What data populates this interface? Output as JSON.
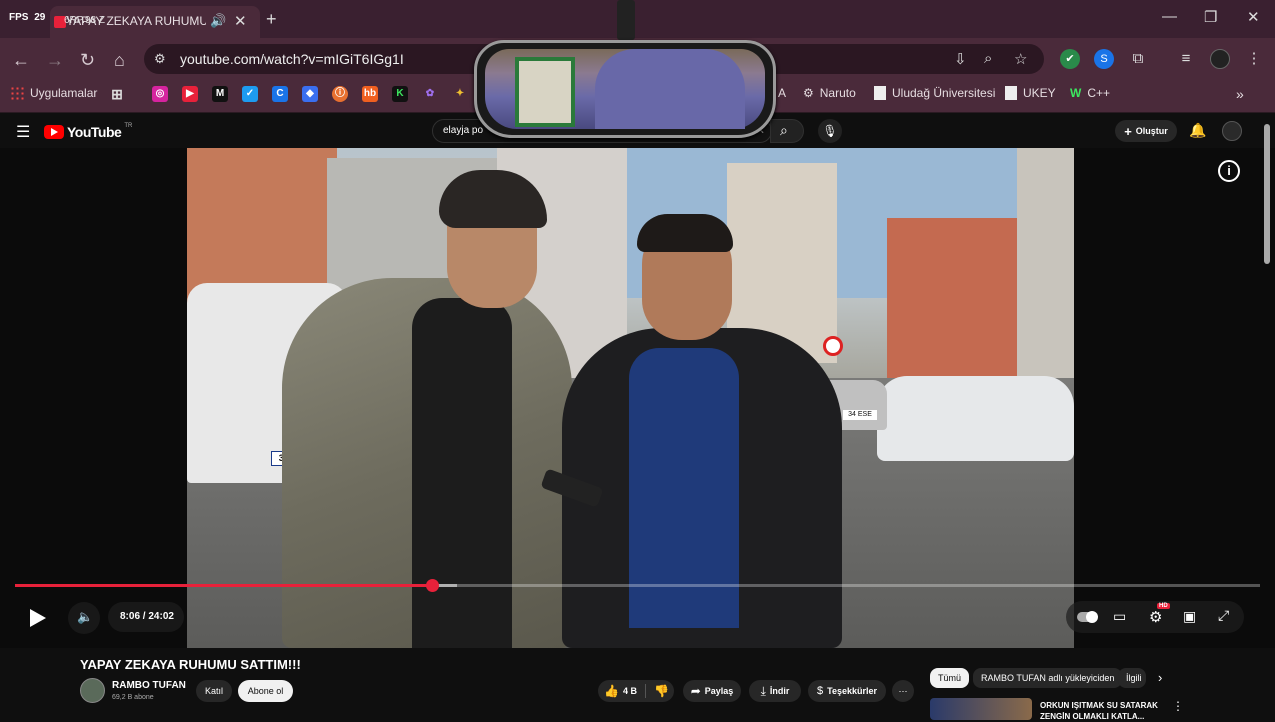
{
  "browser": {
    "fps_label": "FPS",
    "fps_value": "29",
    "tab_title": "YAPAY ZEKAYA RUHUMU SA",
    "tab_overlay_text": "6RP.98 Z",
    "url": "youtube.com/watch?v=mIGiT6IGg1I"
  },
  "bookmarks": {
    "apps_label": "Uygulamalar",
    "items": [
      {
        "label": "A"
      },
      {
        "label": "Naruto"
      },
      {
        "label": "Uludağ Üniversitesi"
      },
      {
        "label": "UKEY"
      },
      {
        "label": "C++"
      }
    ]
  },
  "youtube": {
    "logo_text": "YouTube",
    "logo_region": "TR",
    "search_value": "elayja po",
    "create_label": "Oluştur"
  },
  "player": {
    "time_current": "8:06",
    "time_total": "24:02",
    "time_separator": " / ",
    "progress_fraction": 0.335,
    "buffered_fraction": 0.355,
    "hd_badge": "HD"
  },
  "video": {
    "title": "YAPAY ZEKAYA RUHUMU SATTIM!!!",
    "channel_name": "RAMBO TUFAN",
    "subscribers": "69,2 B abone",
    "join_label": "Katıl",
    "subscribe_label": "Abone ol",
    "like_count": "4 B",
    "share_label": "Paylaş",
    "download_label": "İndir",
    "thanks_label": "Teşekkürler",
    "plate_left": "34 FR",
    "plate_right": "34 ESE"
  },
  "recommendations": {
    "chips": [
      "Tümü",
      "RAMBO TUFAN adlı yükleyiciden",
      "İlgili"
    ],
    "first_title_line1": "ORKUN IŞITMAK SU SATARAK",
    "first_title_line2": "ZENGİN OLMAKLI KATLA..."
  },
  "colors": {
    "accent_red": "#e8213a",
    "browser_frame": "#4a2a3a",
    "yt_bg": "#0f0f0f"
  }
}
